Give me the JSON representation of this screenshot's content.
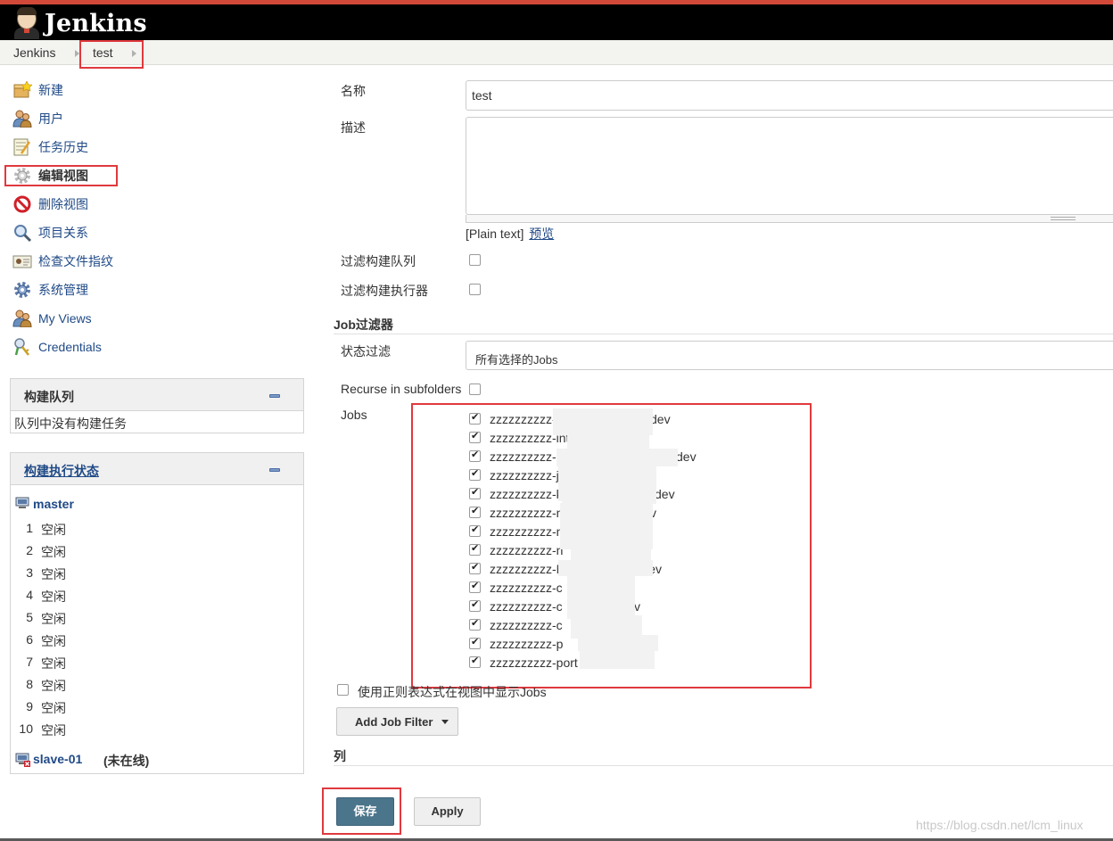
{
  "header": {
    "logo_text": "Jenkins"
  },
  "breadcrumb": [
    {
      "label": "Jenkins"
    },
    {
      "label": "test"
    }
  ],
  "tasks": [
    {
      "label": "新建",
      "icon": "new-item-icon"
    },
    {
      "label": "用户",
      "icon": "users-icon"
    },
    {
      "label": "任务历史",
      "icon": "notepad-icon"
    },
    {
      "label": "编辑视图",
      "icon": "gear-icon"
    },
    {
      "label": "删除视图",
      "icon": "no-entry-icon"
    },
    {
      "label": "项目关系",
      "icon": "magnifier-icon"
    },
    {
      "label": "检查文件指纹",
      "icon": "fingerprint-icon"
    },
    {
      "label": "系统管理",
      "icon": "gear-icon"
    },
    {
      "label": "My Views",
      "icon": "users-icon"
    },
    {
      "label": "Credentials",
      "icon": "keys-icon"
    }
  ],
  "queue": {
    "title": "构建队列",
    "empty_text": "队列中没有构建任务"
  },
  "executors": {
    "title": "构建执行状态",
    "master_label": "master",
    "slots": [
      {
        "num": "1",
        "status": "空闲"
      },
      {
        "num": "2",
        "status": "空闲"
      },
      {
        "num": "3",
        "status": "空闲"
      },
      {
        "num": "4",
        "status": "空闲"
      },
      {
        "num": "5",
        "status": "空闲"
      },
      {
        "num": "6",
        "status": "空闲"
      },
      {
        "num": "7",
        "status": "空闲"
      },
      {
        "num": "8",
        "status": "空闲"
      },
      {
        "num": "9",
        "status": "空闲"
      },
      {
        "num": "10",
        "status": "空闲"
      }
    ],
    "slave_label": "slave-01",
    "slave_status": "(未在线)"
  },
  "form": {
    "name_label": "名称",
    "name_value": "test",
    "desc_label": "描述",
    "desc_value": "",
    "plain_text": "[Plain text]",
    "preview": "预览",
    "filter_queue_label": "过滤构建队列",
    "filter_executors_label": "过滤构建执行器",
    "job_filter_section": "Job过滤器",
    "status_filter_label": "状态过滤",
    "status_filter_value": "所有选择的Jobs",
    "recurse_label": "Recurse in subfolders",
    "jobs_label": "Jobs",
    "jobs": [
      {
        "name": "zzzzzzzzzz-",
        "tail": "dev",
        "checked": true
      },
      {
        "name": "zzzzzzzzzz-int",
        "tail": "",
        "checked": true
      },
      {
        "name": "zzzzzzzzzz-In",
        "tail": "dev",
        "checked": true
      },
      {
        "name": "zzzzzzzzzz-ju",
        "tail": "v",
        "checked": true
      },
      {
        "name": "zzzzzzzzzz-k",
        "tail": "dev",
        "checked": true
      },
      {
        "name": "zzzzzzzzzz-n",
        "tail": "v",
        "checked": true
      },
      {
        "name": "zzzzzzzzzz-n",
        "tail": "",
        "checked": true
      },
      {
        "name": "zzzzzzzzzz-n",
        "tail": "",
        "checked": true
      },
      {
        "name": "zzzzzzzzzz-N",
        "tail": "o-dev",
        "checked": true
      },
      {
        "name": "zzzzzzzzzz-c",
        "tail": "",
        "checked": true
      },
      {
        "name": "zzzzzzzzzz-c",
        "tail": "v",
        "checked": true
      },
      {
        "name": "zzzzzzzzzz-c",
        "tail": "",
        "checked": true
      },
      {
        "name": "zzzzzzzzzz-p",
        "tail": "",
        "checked": true
      },
      {
        "name": "zzzzzzzzzz-port",
        "tail": "",
        "checked": true
      }
    ],
    "regex_label": "使用正则表达式在视图中显示Jobs",
    "add_filter_label": "Add Job Filter",
    "columns_section": "列",
    "save_label": "保存",
    "apply_label": "Apply"
  },
  "watermark": "https://blog.csdn.net/lcm_linux",
  "colors": {
    "accent": "#d24939",
    "highlight_box": "#e0393e",
    "save_button": "#4b758b",
    "link": "#204a87"
  }
}
